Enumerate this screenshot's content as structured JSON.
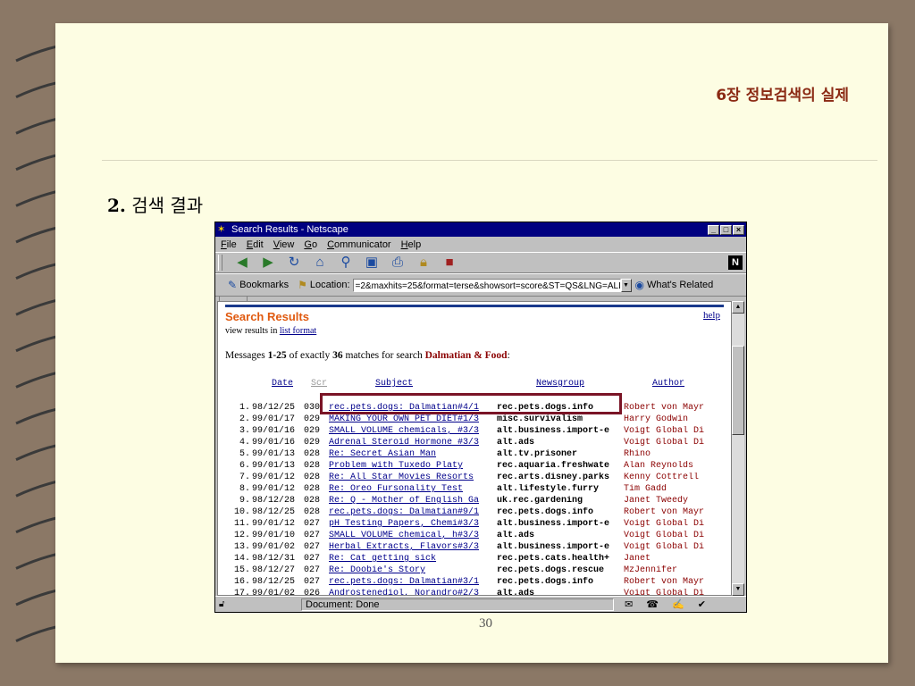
{
  "slide": {
    "chapter_title": "6장  정보검색의 실제",
    "section_num": "2.",
    "section_title": "검색 결과",
    "page_number": "30"
  },
  "browser": {
    "window_title": "Search Results - Netscape",
    "menu": [
      "File",
      "Edit",
      "View",
      "Go",
      "Communicator",
      "Help"
    ],
    "bookmarks_label": "Bookmarks",
    "location_label": "Location:",
    "location_value": "=2&maxhits=25&format=terse&showsort=score&ST=QS&LNG=ALL",
    "whats_related": "What's Related",
    "status_text": "Document: Done"
  },
  "results": {
    "title": "Search Results",
    "help_label": "help",
    "view_prefix": "view results in",
    "view_link": "list format",
    "msg_prefix": "Messages",
    "msg_range": "1-25",
    "msg_middle": "of exactly",
    "msg_count": "36",
    "msg_suffix": "matches for search",
    "msg_query": "Dalmatian & Food",
    "msg_colon": ":",
    "columns": {
      "date": "Date",
      "scr": "Scr",
      "subject": "Subject",
      "newsgroup": "Newsgroup",
      "author": "Author"
    },
    "rows": [
      [
        "1.",
        "98/12/25",
        "030",
        "rec.pets.dogs: Dalmatian#4/1",
        "rec.pets.dogs.info",
        "Robert von Mayr"
      ],
      [
        "2.",
        "99/01/17",
        "029",
        "MAKING YOUR OWN PET DIET#1/3",
        "misc.survivalism",
        "Harry Godwin"
      ],
      [
        "3.",
        "99/01/16",
        "029",
        "SMALL VOLUME chemicals, #3/3",
        "alt.business.import-e",
        "Voigt Global Di"
      ],
      [
        "4.",
        "99/01/16",
        "029",
        "Adrenal Steroid Hormone #3/3",
        "alt.ads",
        "Voigt Global Di"
      ],
      [
        "5.",
        "99/01/13",
        "028",
        "Re: Secret Asian Man",
        "alt.tv.prisoner",
        "Rhino"
      ],
      [
        "6.",
        "99/01/13",
        "028",
        "Problem with Tuxedo Platy",
        "rec.aquaria.freshwate",
        "Alan Reynolds"
      ],
      [
        "7.",
        "99/01/12",
        "028",
        "Re: All Star Movies Resorts",
        "rec.arts.disney.parks",
        "Kenny Cottrell"
      ],
      [
        "8.",
        "99/01/12",
        "028",
        "Re: Oreo Fursonality Test",
        "alt.lifestyle.furry",
        "Tim Gadd"
      ],
      [
        "9.",
        "98/12/28",
        "028",
        "Re: Q - Mother of English Ga",
        "uk.rec.gardening",
        "Janet Tweedy"
      ],
      [
        "10.",
        "98/12/25",
        "028",
        "rec.pets.dogs: Dalmatian#9/1",
        "rec.pets.dogs.info",
        "Robert von Mayr"
      ],
      [
        "11.",
        "99/01/12",
        "027",
        "pH Testing Papers, Chemi#3/3",
        "alt.business.import-e",
        "Voigt Global Di"
      ],
      [
        "12.",
        "99/01/10",
        "027",
        "SMALL VOLUME chemical, h#3/3",
        "alt.ads",
        "Voigt Global Di"
      ],
      [
        "13.",
        "99/01/02",
        "027",
        "Herbal Extracts, Flavors#3/3",
        "alt.business.import-e",
        "Voigt Global Di"
      ],
      [
        "14.",
        "98/12/31",
        "027",
        "Re: Cat getting sick",
        "rec.pets.cats.health+",
        "Janet"
      ],
      [
        "15.",
        "98/12/27",
        "027",
        "Re: Doobie's Story",
        "rec.pets.dogs.rescue",
        "MzJennifer"
      ],
      [
        "16.",
        "98/12/25",
        "027",
        "rec.pets.dogs: Dalmatian#3/1",
        "rec.pets.dogs.info",
        "Robert von Mayr"
      ],
      [
        "17.",
        "99/01/02",
        "026",
        "Androstenediol, Norandro#2/3",
        "alt.ads",
        "Voigt Global Di"
      ]
    ]
  },
  "icons": {
    "title": "netscape-logo-icon",
    "toolbar": [
      "back-icon",
      "forward-icon",
      "reload-icon",
      "home-icon",
      "search-icon",
      "netscape-icon",
      "print-icon",
      "security-icon",
      "stop-icon"
    ]
  },
  "colors": {
    "page_bg": "#fdfde3",
    "desk_bg": "#8b7866",
    "chapter_title": "#8b2a14",
    "results_title": "#e05a10",
    "highlight_box": "#7a1426",
    "link": "#00008b"
  }
}
